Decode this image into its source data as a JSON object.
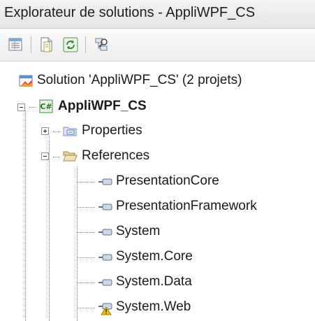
{
  "window": {
    "title": "Explorateur de solutions - AppliWPF_CS"
  },
  "toolbar": {
    "buttons": [
      {
        "icon": "properties-icon"
      },
      {
        "icon": "show-all-files-icon"
      },
      {
        "icon": "refresh-icon"
      },
      {
        "icon": "view-class-diagram-icon"
      }
    ]
  },
  "tree": {
    "solution": {
      "label": "Solution 'AppliWPF_CS' (2 projets)",
      "icon": "solution-icon"
    },
    "project": {
      "label": "AppliWPF_CS",
      "icon": "csharp-project-icon",
      "expanded": true,
      "children": {
        "properties": {
          "label": "Properties",
          "icon": "properties-folder-icon",
          "expanded": false
        },
        "references": {
          "label": "References",
          "icon": "open-folder-icon",
          "expanded": true,
          "items": [
            {
              "label": "PresentationCore",
              "icon": "reference-icon"
            },
            {
              "label": "PresentationFramework",
              "icon": "reference-icon"
            },
            {
              "label": "System",
              "icon": "reference-icon"
            },
            {
              "label": "System.Core",
              "icon": "reference-icon"
            },
            {
              "label": "System.Data",
              "icon": "reference-icon"
            },
            {
              "label": "System.Web",
              "icon": "reference-warning-icon",
              "warning": true
            }
          ]
        }
      }
    }
  },
  "colors": {
    "accent": "#2b6fc2",
    "warning": "#f2c200",
    "folder": "#e8c46a"
  }
}
